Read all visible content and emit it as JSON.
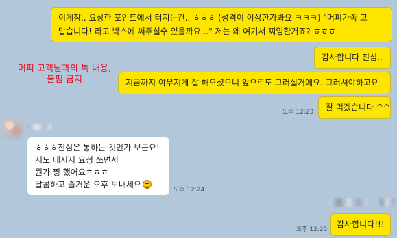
{
  "watermark": {
    "line1": "머피 고객님과의 톡 내용,",
    "line2": "불펌 금지"
  },
  "messages": [
    {
      "from": "me",
      "lines": [
        "이게참.. 요상한 포인트에서 터지는건.. ㅎㅎㅎ (성격이 이상한가봐요 ㅋㅋㅋ) \"머피가족 고",
        "맙습니다! 라고 박스에 써주실수 있을까요...\" 저는 왜 여기서 찌잉한거죠? ㅎㅎㅎ"
      ]
    },
    {
      "from": "me",
      "lines": [
        "감사합니다 진심.."
      ]
    },
    {
      "from": "me",
      "lines": [
        "지금까지 야무지게 잘 해오셨으니 앞으로도 그러실거에요. 그러셔야하고요"
      ]
    },
    {
      "from": "me",
      "lines": [
        "잘 먹겠습니다 ^^"
      ],
      "time": "오후 12:23"
    },
    {
      "from": "other",
      "lines": [
        "ㅎㅎㅎ진심은 통하는 것인가 보군요!",
        "저도 메시지 요청 쓰면서",
        "뭔가 찡 했어요ㅎㅎㅎ",
        "달콤하고 즐거운 오후 보내세요"
      ],
      "emoji": "grinning-face",
      "time": "오후 12:24"
    },
    {
      "from": "me",
      "lines": [
        "감사합니다!!!"
      ],
      "time": "오후 12:25"
    }
  ],
  "colors": {
    "background": "#b2c7da",
    "my_bubble": "#fee500",
    "other_bubble": "#ffffff",
    "watermark": "#e4162a"
  }
}
